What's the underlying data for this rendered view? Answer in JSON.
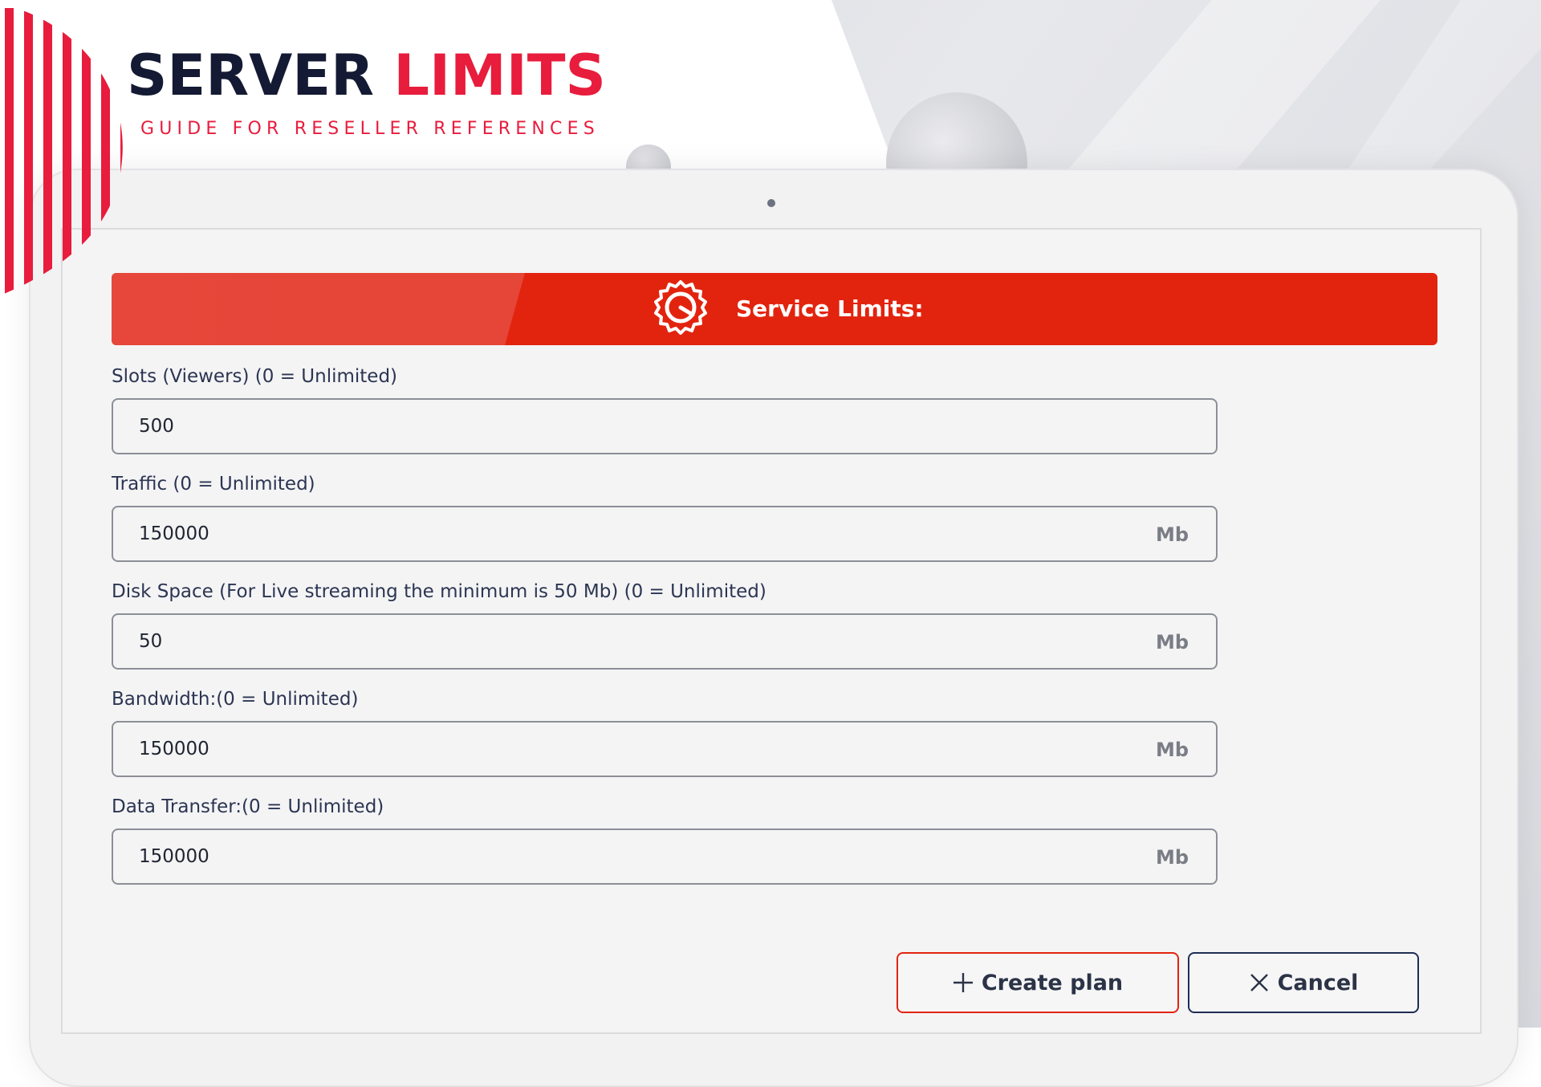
{
  "header": {
    "title_part1": "SERVER",
    "title_part2": "LIMITS",
    "subtitle": "GUIDE FOR RESELLER REFERENCES"
  },
  "banner": {
    "title": "Service Limits:",
    "icon": "gauge-icon"
  },
  "form": {
    "fields": [
      {
        "label": "Slots (Viewers) (0 = Unlimited)",
        "value": "500",
        "unit": ""
      },
      {
        "label": "Traffic (0 = Unlimited)",
        "value": "150000",
        "unit": "Mb"
      },
      {
        "label": "Disk Space (For Live streaming the minimum is 50 Mb) (0 = Unlimited)",
        "value": "50",
        "unit": "Mb"
      },
      {
        "label": "Bandwidth:(0 = Unlimited)",
        "value": "150000",
        "unit": "Mb"
      },
      {
        "label": "Data Transfer:(0 = Unlimited)",
        "value": "150000",
        "unit": "Mb"
      }
    ]
  },
  "actions": {
    "create_label": "Create plan",
    "create_icon": "plus-icon",
    "cancel_label": "Cancel",
    "cancel_icon": "close-icon"
  },
  "colors": {
    "accent_red": "#e81c3c",
    "banner_red": "#e2240f",
    "title_navy": "#141a33",
    "cancel_border": "#1f2d54"
  }
}
